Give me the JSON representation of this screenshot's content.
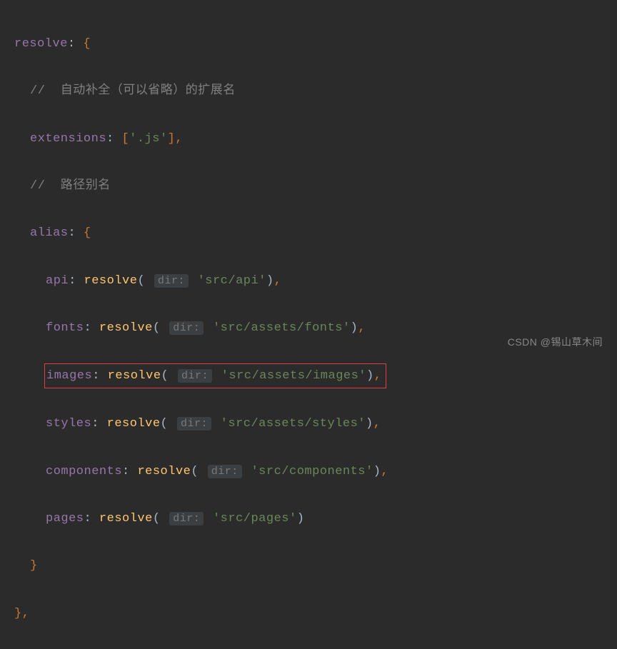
{
  "code": {
    "line1": {
      "prop": "resolve",
      "colon": ": ",
      "brace": "{"
    },
    "line2": {
      "comment": "// ",
      "text": " 自动补全（可以省略）的扩展名"
    },
    "line3": {
      "prop": "extensions",
      "colon": ": ",
      "bracket1": "[",
      "val": "'.js'",
      "bracket2": "]",
      "comma": ","
    },
    "line4": {
      "comment": "// ",
      "text": " 路径别名"
    },
    "line5": {
      "prop": "alias",
      "colon": ": ",
      "brace": "{"
    },
    "alias_items": [
      {
        "key": "api",
        "hint": "dir:",
        "val": "'src/api'",
        "comma": ","
      },
      {
        "key": "fonts",
        "hint": "dir:",
        "val": "'src/assets/fonts'",
        "comma": ","
      },
      {
        "key": "images",
        "hint": "dir:",
        "val": "'src/assets/images'",
        "comma": ","
      },
      {
        "key": "styles",
        "hint": "dir:",
        "val": "'src/assets/styles'",
        "comma": ","
      },
      {
        "key": "components",
        "hint": "dir:",
        "val": "'src/components'",
        "comma": ","
      },
      {
        "key": "pages",
        "hint": "dir:",
        "val": "'src/pages'",
        "comma": ""
      }
    ],
    "resolve_fn": "resolve",
    "close_brace": "}",
    "close_brace_comma": "},"
  },
  "watermark": "CSDN @锡山草木间"
}
